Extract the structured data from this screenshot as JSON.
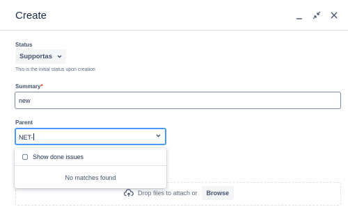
{
  "dialog": {
    "title": "Create"
  },
  "header_icons": [
    "minimize-icon",
    "collapse-icon",
    "close-icon"
  ],
  "status": {
    "label": "Status",
    "value": "Supportas",
    "helper": "This is the initial status upon creation"
  },
  "summary": {
    "label": "Summary",
    "required_marker": "*",
    "value": "new"
  },
  "parent": {
    "label": "Parent",
    "value": "NET-"
  },
  "dropdown": {
    "checkbox_label": "Show done issues",
    "checked": false,
    "empty_message": "No matches found"
  },
  "attachments": {
    "drop_text": "Drop files to attach or",
    "browse_label": "Browse"
  },
  "colors": {
    "focus_border": "#4c9aff",
    "text": "#172b4d",
    "required": "#de350b"
  }
}
